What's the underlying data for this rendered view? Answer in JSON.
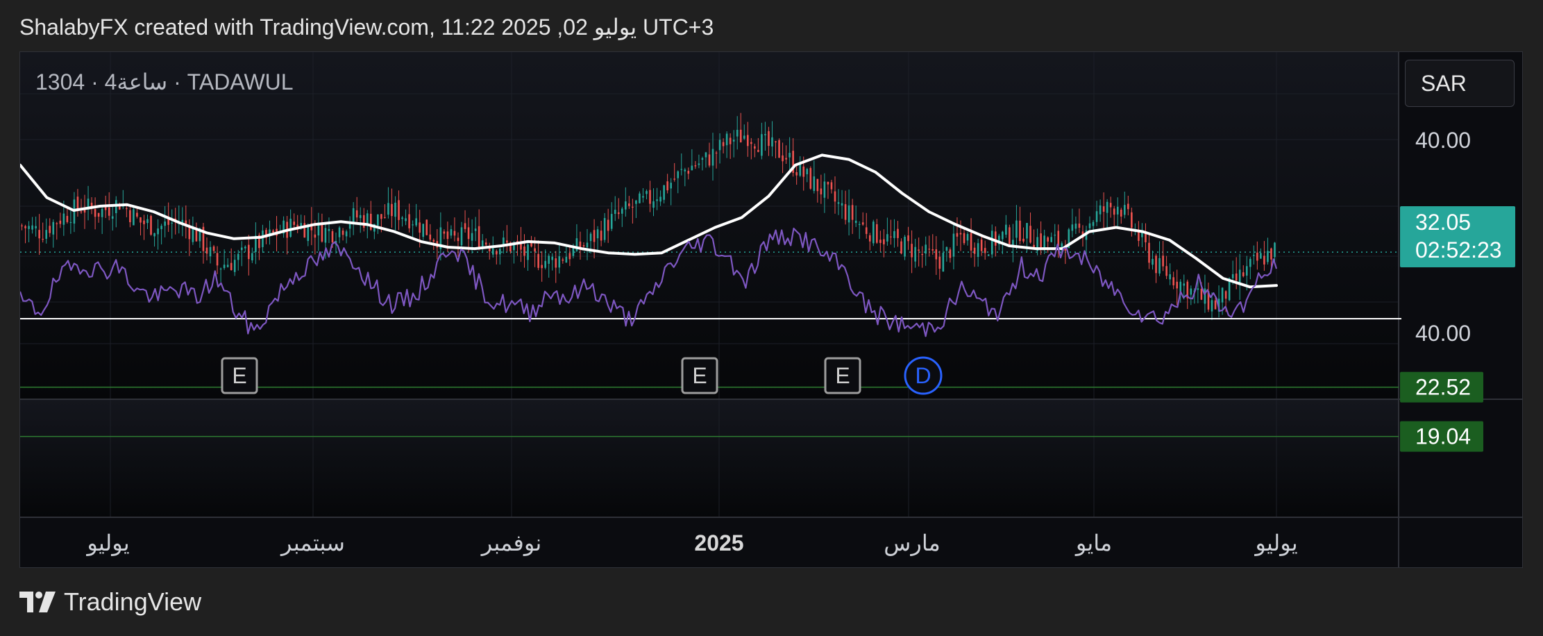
{
  "header": {
    "title": "ShalabyFX created with TradingView.com, 11:22 2025 ,02 يوليو UTC+3"
  },
  "symbol": {
    "label": "1304 · 4ساعة · TADAWUL"
  },
  "currency": {
    "label": "SAR"
  },
  "footer": {
    "brand": "TradingView"
  },
  "colors": {
    "background": "#0b0c10",
    "up": "#26a69a",
    "down": "#ef5350",
    "ma": "#ffffff",
    "rsi": "#7e57c2",
    "price_badge": "#26a69a",
    "level_badge": "#1b5e20",
    "level_line": "#2e7d32",
    "event_e": "#9e9e9e",
    "event_d": "#2962ff"
  },
  "chart_data": {
    "type": "candlestick",
    "x_labels": [
      "يوليو",
      "سبتمبر",
      "نوفمبر",
      "2025",
      "مارس",
      "مايو",
      "يوليو"
    ],
    "y_label": "40.00",
    "price_badge": {
      "value": "32.05",
      "countdown": "02:52:23"
    },
    "horizontal_levels": [
      22.52,
      19.04
    ],
    "close_series": [
      33.9,
      33.5,
      34.5,
      35.3,
      34.9,
      35.6,
      34.2,
      33.8,
      34.3,
      33.2,
      31.1,
      31.5,
      32.6,
      33.4,
      34.1,
      33.6,
      33.5,
      34.6,
      34.2,
      35.0,
      34.4,
      33.2,
      32.9,
      33.3,
      32.6,
      32.5,
      31.7,
      31.4,
      32.0,
      32.8,
      34.2,
      35.1,
      35.7,
      36.8,
      38.0,
      38.6,
      39.8,
      40.4,
      39.6,
      38.9,
      37.4,
      36.3,
      35.0,
      33.8,
      33.1,
      32.6,
      31.9,
      31.5,
      33.3,
      32.4,
      33.1,
      33.6,
      32.9,
      32.7,
      33.5,
      34.8,
      35.5,
      33.2,
      31.0,
      30.1,
      29.0,
      28.3,
      30.0,
      31.3,
      32.2
    ],
    "moving_average": [
      38.2,
      35.9,
      35.0,
      35.3,
      35.4,
      34.9,
      34.1,
      33.4,
      33.0,
      33.1,
      33.6,
      34.0,
      34.2,
      34.0,
      33.5,
      32.8,
      32.4,
      32.3,
      32.5,
      32.8,
      32.7,
      32.3,
      32.0,
      31.9,
      32.0,
      32.9,
      33.8,
      34.5,
      36.0,
      38.2,
      38.9,
      38.6,
      37.7,
      36.2,
      34.9,
      34.0,
      33.2,
      32.5,
      32.3,
      32.3,
      33.5,
      33.8,
      33.5,
      32.9,
      31.6,
      30.2,
      29.6,
      29.7
    ],
    "rsi_level": 40.0,
    "rsi_series": [
      45,
      42,
      52,
      56,
      54,
      55,
      48,
      46,
      49,
      46,
      52,
      42,
      36,
      46,
      53,
      56,
      60,
      57,
      49,
      44,
      46,
      53,
      62,
      53,
      45,
      44,
      42,
      48,
      46,
      50,
      44,
      40,
      45,
      55,
      60,
      63,
      58,
      51,
      62,
      64,
      63,
      58,
      54,
      44,
      40,
      38,
      37,
      40,
      49,
      44,
      42,
      55,
      53,
      60,
      58,
      52,
      47,
      42,
      40,
      45,
      50,
      44,
      42,
      50,
      56
    ]
  },
  "events": [
    {
      "letter": "E"
    },
    {
      "letter": "E"
    },
    {
      "letter": "E"
    },
    {
      "letter": "D"
    }
  ]
}
